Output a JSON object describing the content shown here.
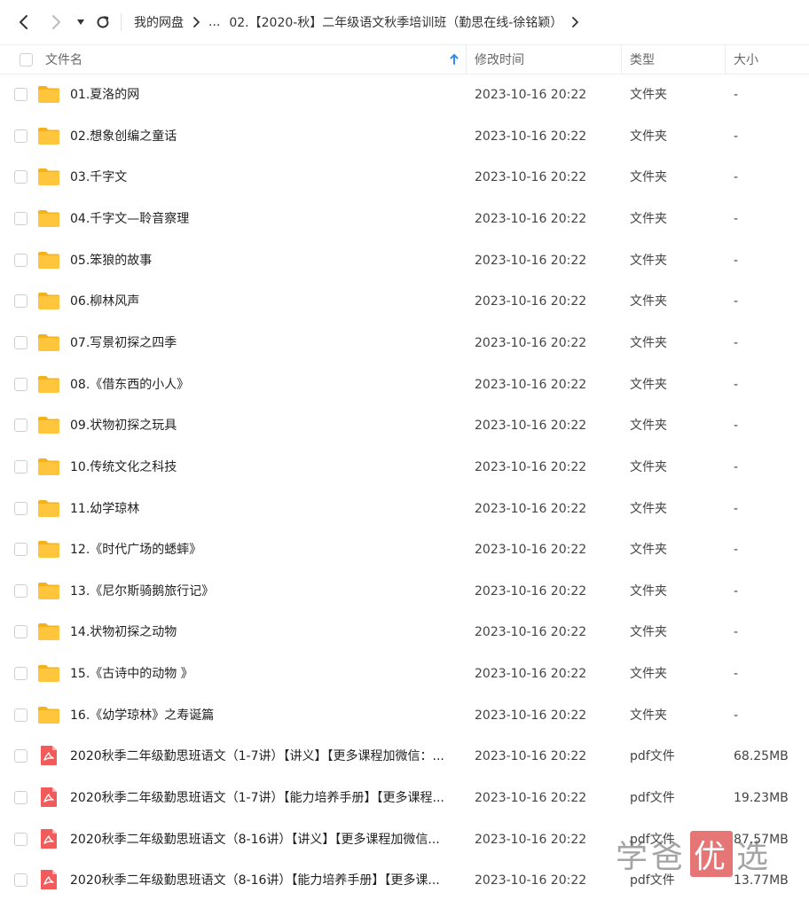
{
  "breadcrumb": {
    "root": "我的网盘",
    "ellipsis": "...",
    "current": "02.【2020-秋】二年级语文秋季培训班（勤思在线-徐铭颖）"
  },
  "columns": {
    "name": "文件名",
    "modified": "修改时间",
    "type": "类型",
    "size": "大小"
  },
  "files": [
    {
      "name": "01.夏洛的网",
      "time": "2023-10-16 20:22",
      "type": "文件夹",
      "size": "-",
      "icon": "folder-icon"
    },
    {
      "name": "02.想象创编之童话",
      "time": "2023-10-16 20:22",
      "type": "文件夹",
      "size": "-",
      "icon": "folder-icon"
    },
    {
      "name": "03.千字文",
      "time": "2023-10-16 20:22",
      "type": "文件夹",
      "size": "-",
      "icon": "folder-icon"
    },
    {
      "name": "04.千字文—聆音察理",
      "time": "2023-10-16 20:22",
      "type": "文件夹",
      "size": "-",
      "icon": "folder-icon"
    },
    {
      "name": "05.笨狼的故事",
      "time": "2023-10-16 20:22",
      "type": "文件夹",
      "size": "-",
      "icon": "folder-icon"
    },
    {
      "name": "06.柳林风声",
      "time": "2023-10-16 20:22",
      "type": "文件夹",
      "size": "-",
      "icon": "folder-icon"
    },
    {
      "name": "07.写景初探之四季",
      "time": "2023-10-16 20:22",
      "type": "文件夹",
      "size": "-",
      "icon": "folder-icon"
    },
    {
      "name": "08.《借东西的小人》",
      "time": "2023-10-16 20:22",
      "type": "文件夹",
      "size": "-",
      "icon": "folder-icon"
    },
    {
      "name": "09.状物初探之玩具",
      "time": "2023-10-16 20:22",
      "type": "文件夹",
      "size": "-",
      "icon": "folder-icon"
    },
    {
      "name": "10.传统文化之科技",
      "time": "2023-10-16 20:22",
      "type": "文件夹",
      "size": "-",
      "icon": "folder-icon"
    },
    {
      "name": "11.幼学琼林",
      "time": "2023-10-16 20:22",
      "type": "文件夹",
      "size": "-",
      "icon": "folder-icon"
    },
    {
      "name": "12.《时代广场的蟋蟀》",
      "time": "2023-10-16 20:22",
      "type": "文件夹",
      "size": "-",
      "icon": "folder-icon"
    },
    {
      "name": "13.《尼尔斯骑鹅旅行记》",
      "time": "2023-10-16 20:22",
      "type": "文件夹",
      "size": "-",
      "icon": "folder-icon"
    },
    {
      "name": "14.状物初探之动物",
      "time": "2023-10-16 20:22",
      "type": "文件夹",
      "size": "-",
      "icon": "folder-icon"
    },
    {
      "name": "15.《古诗中的动物 》",
      "time": "2023-10-16 20:22",
      "type": "文件夹",
      "size": "-",
      "icon": "folder-icon"
    },
    {
      "name": "16.《幼学琼林》之寿诞篇",
      "time": "2023-10-16 20:22",
      "type": "文件夹",
      "size": "-",
      "icon": "folder-icon"
    },
    {
      "name": "2020秋季二年级勤思班语文（1-7讲）【讲义】【更多课程加微信：...",
      "time": "2023-10-16 20:22",
      "type": "pdf文件",
      "size": "68.25MB",
      "icon": "pdf-icon"
    },
    {
      "name": "2020秋季二年级勤思班语文（1-7讲）【能力培养手册】【更多课程...",
      "time": "2023-10-16 20:22",
      "type": "pdf文件",
      "size": "19.23MB",
      "icon": "pdf-icon"
    },
    {
      "name": "2020秋季二年级勤思班语文（8-16讲）【讲义】【更多课程加微信...",
      "time": "2023-10-16 20:22",
      "type": "pdf文件",
      "size": "87.57MB",
      "icon": "pdf-icon"
    },
    {
      "name": "2020秋季二年级勤思班语文（8-16讲）【能力培养手册】【更多课...",
      "time": "2023-10-16 20:22",
      "type": "pdf文件",
      "size": "13.77MB",
      "icon": "pdf-icon"
    }
  ],
  "watermark": {
    "part1": "学爸",
    "stamp": "优",
    "part2": "选"
  },
  "colors": {
    "folder": "#FFC53D",
    "folder_dark": "#F5B21B",
    "pdf": "#F25B5B",
    "sort_arrow": "#2E8CF0"
  }
}
